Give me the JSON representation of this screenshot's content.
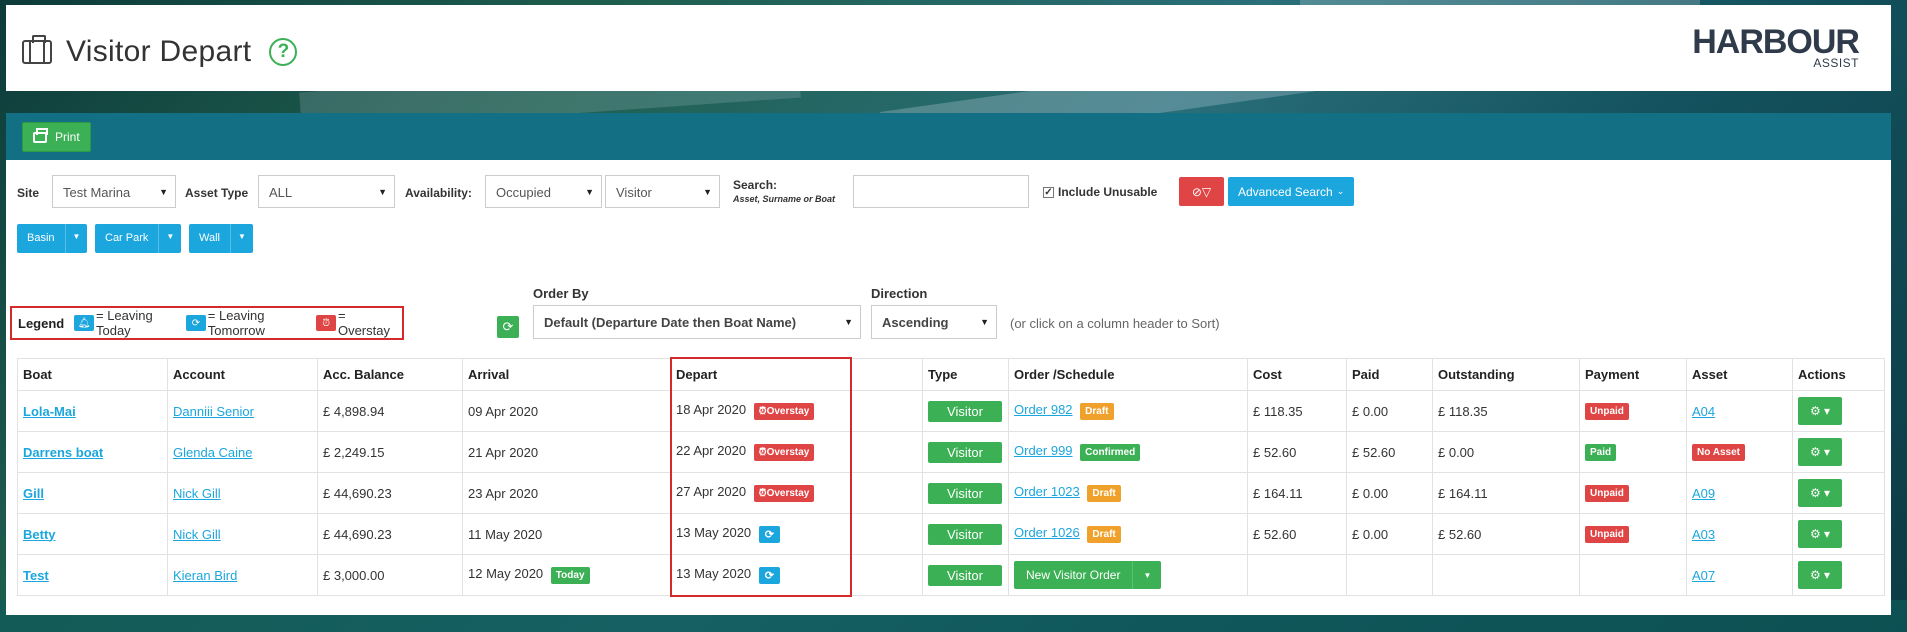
{
  "page": {
    "title": "Visitor Depart",
    "help_icon": "?",
    "logo_main": "HARBOUR",
    "logo_sub": "ASSIST"
  },
  "toolbar": {
    "print_label": "Print"
  },
  "filters": {
    "site_label": "Site",
    "site_value": "Test Marina",
    "asset_type_label": "Asset Type",
    "asset_type_value": "ALL",
    "availability_label": "Availability:",
    "availability_value": "Occupied",
    "visitor_value": "Visitor",
    "search_label": "Search:",
    "search_hint": "Asset, Surname or Boat",
    "search_value": "",
    "include_unusable_label": "Include Unusable",
    "include_unusable_checked": true,
    "advanced_search_label": "Advanced Search",
    "areas": [
      "Basin",
      "Car Park",
      "Wall"
    ]
  },
  "legend": {
    "title": "Legend",
    "today_text": "= Leaving Today",
    "tomorrow_text": "= Leaving Tomorrow",
    "overstay_text": "= Overstay"
  },
  "order_by": {
    "label": "Order By",
    "value": "Default (Departure Date then Boat Name)"
  },
  "direction": {
    "label": "Direction",
    "value": "Ascending",
    "hint": "(or click on a column header to Sort)"
  },
  "table": {
    "headers": [
      "Boat",
      "Account",
      "Acc. Balance",
      "Arrival",
      "Depart",
      "Type",
      "Order /Schedule",
      "Cost",
      "Paid",
      "Outstanding",
      "Payment",
      "Asset",
      "Actions"
    ],
    "rows": [
      {
        "boat": "Lola-Mai",
        "account": "Danniii Senior",
        "balance": "£ 4,898.94",
        "arrival": "09 Apr 2020",
        "arrival_badge": "",
        "depart": "18 Apr 2020",
        "depart_badge": "Overstay",
        "type": "Visitor",
        "order": "Order 982",
        "order_status": "Draft",
        "cost": "£ 118.35",
        "paid": "£ 0.00",
        "outstanding": "£ 118.35",
        "payment": "Unpaid",
        "asset": "A04"
      },
      {
        "boat": "Darrens boat",
        "account": "Glenda Caine",
        "balance": "£ 2,249.15",
        "arrival": "21 Apr 2020",
        "arrival_badge": "",
        "depart": "22 Apr 2020",
        "depart_badge": "Overstay",
        "type": "Visitor",
        "order": "Order 999",
        "order_status": "Confirmed",
        "cost": "£ 52.60",
        "paid": "£ 52.60",
        "outstanding": "£ 0.00",
        "payment": "Paid",
        "asset": "No Asset"
      },
      {
        "boat": "Gill",
        "account": "Nick Gill",
        "balance": "£ 44,690.23",
        "arrival": "23 Apr 2020",
        "arrival_badge": "",
        "depart": "27 Apr 2020",
        "depart_badge": "Overstay",
        "type": "Visitor",
        "order": "Order 1023",
        "order_status": "Draft",
        "cost": "£ 164.11",
        "paid": "£ 0.00",
        "outstanding": "£ 164.11",
        "payment": "Unpaid",
        "asset": "A09"
      },
      {
        "boat": "Betty",
        "account": "Nick Gill",
        "balance": "£ 44,690.23",
        "arrival": "11 May 2020",
        "arrival_badge": "",
        "depart": "13 May 2020",
        "depart_badge": "tomorrow",
        "type": "Visitor",
        "order": "Order 1026",
        "order_status": "Draft",
        "cost": "£ 52.60",
        "paid": "£ 0.00",
        "outstanding": "£ 52.60",
        "payment": "Unpaid",
        "asset": "A03"
      },
      {
        "boat": "Test",
        "account": "Kieran Bird",
        "balance": "£ 3,000.00",
        "arrival": "12 May 2020",
        "arrival_badge": "Today",
        "depart": "13 May 2020",
        "depart_badge": "tomorrow",
        "type": "Visitor",
        "order": "",
        "order_button": "New Visitor Order",
        "order_status": "",
        "cost": "",
        "paid": "",
        "outstanding": "",
        "payment": "",
        "asset": "A07"
      }
    ]
  },
  "colors": {
    "primary_green": "#3cb054",
    "primary_blue": "#1ba6dd",
    "danger_red": "#e04545",
    "warning_orange": "#f0a12c",
    "header_bar": "#126f84"
  }
}
